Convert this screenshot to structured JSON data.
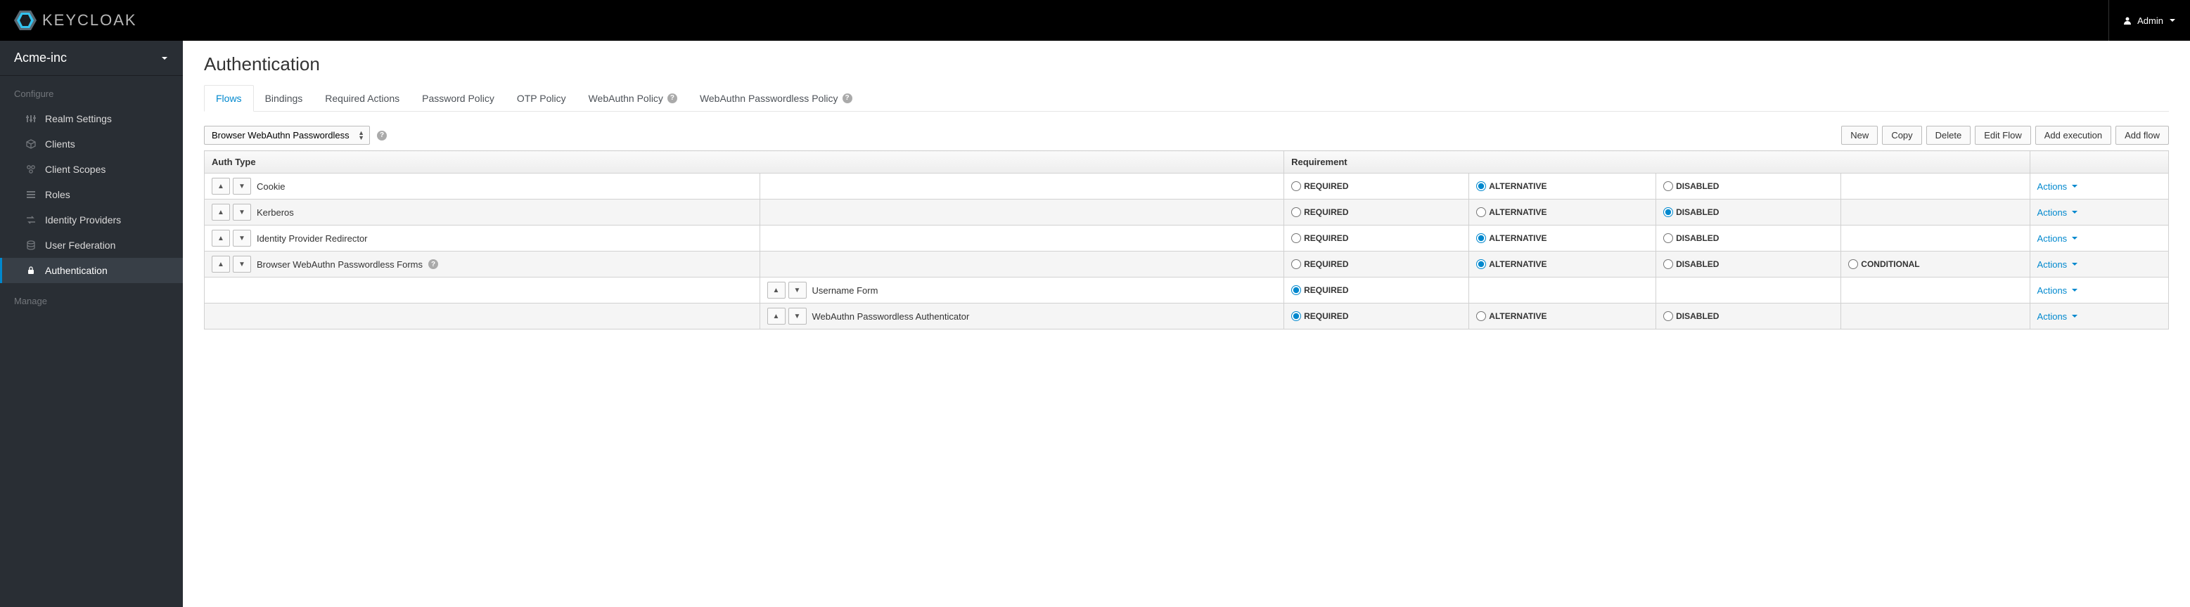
{
  "header": {
    "brand": "KEYCLOAK",
    "user_label": "Admin"
  },
  "sidebar": {
    "realm": "Acme-inc",
    "sections": [
      {
        "title": "Configure",
        "items": [
          {
            "label": "Realm Settings",
            "icon": "sliders",
            "active": false
          },
          {
            "label": "Clients",
            "icon": "cube",
            "active": false
          },
          {
            "label": "Client Scopes",
            "icon": "scopes",
            "active": false
          },
          {
            "label": "Roles",
            "icon": "list",
            "active": false
          },
          {
            "label": "Identity Providers",
            "icon": "exchange",
            "active": false
          },
          {
            "label": "User Federation",
            "icon": "database",
            "active": false
          },
          {
            "label": "Authentication",
            "icon": "lock",
            "active": true
          }
        ]
      },
      {
        "title": "Manage",
        "items": []
      }
    ]
  },
  "main": {
    "title": "Authentication",
    "tabs": [
      {
        "label": "Flows",
        "active": true,
        "help": false
      },
      {
        "label": "Bindings",
        "active": false,
        "help": false
      },
      {
        "label": "Required Actions",
        "active": false,
        "help": false
      },
      {
        "label": "Password Policy",
        "active": false,
        "help": false
      },
      {
        "label": "OTP Policy",
        "active": false,
        "help": false
      },
      {
        "label": "WebAuthn Policy",
        "active": false,
        "help": true
      },
      {
        "label": "WebAuthn Passwordless Policy",
        "active": false,
        "help": true
      }
    ],
    "flow_selected": "Browser WebAuthn Passwordless",
    "toolbar_buttons": [
      "New",
      "Copy",
      "Delete",
      "Edit Flow",
      "Add execution",
      "Add flow"
    ],
    "table": {
      "headers": {
        "auth_type": "Auth Type",
        "requirement": "Requirement"
      },
      "requirement_labels": {
        "required": "REQUIRED",
        "alternative": "ALTERNATIVE",
        "disabled": "DISABLED",
        "conditional": "CONDITIONAL"
      },
      "actions_label": "Actions",
      "rows": [
        {
          "name": "Cookie",
          "depth": 0,
          "help": false,
          "req": {
            "required": false,
            "alternative": true,
            "disabled": false
          },
          "selected": "alternative"
        },
        {
          "name": "Kerberos",
          "depth": 0,
          "help": false,
          "req": {
            "required": false,
            "alternative": false,
            "disabled": true
          },
          "selected": "disabled"
        },
        {
          "name": "Identity Provider Redirector",
          "depth": 0,
          "help": false,
          "req": {
            "required": false,
            "alternative": true,
            "disabled": false
          },
          "selected": "alternative"
        },
        {
          "name": "Browser WebAuthn Passwordless Forms",
          "depth": 0,
          "help": true,
          "req": {
            "required": false,
            "alternative": true,
            "disabled": false,
            "conditional": false
          },
          "selected": "alternative"
        },
        {
          "name": "Username Form",
          "depth": 1,
          "help": false,
          "req": {
            "required": true
          },
          "selected": "required"
        },
        {
          "name": "WebAuthn Passwordless Authenticator",
          "depth": 1,
          "help": false,
          "req": {
            "required": true,
            "alternative": false,
            "disabled": false
          },
          "selected": "required"
        }
      ]
    }
  }
}
